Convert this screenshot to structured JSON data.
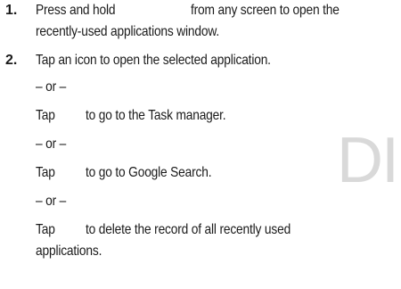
{
  "steps": {
    "step1": {
      "number": "1.",
      "line1_before_icon": "Press and hold",
      "line1_after_icon": "from any screen to open the",
      "line2": "recently-used applications window."
    },
    "step2": {
      "number": "2.",
      "line1": "Tap an icon to open the selected application.",
      "or1": "– or –",
      "task_manager_tap": "Tap",
      "task_manager_text": "to go to the Task manager.",
      "or2": "– or –",
      "google_tap": "Tap",
      "google_text": "to go to Google Search.",
      "or3": "– or –",
      "delete_tap": "Tap",
      "delete_text": "to delete the record of all recently used",
      "delete_text_line2": "applications."
    }
  },
  "watermark": "DI"
}
